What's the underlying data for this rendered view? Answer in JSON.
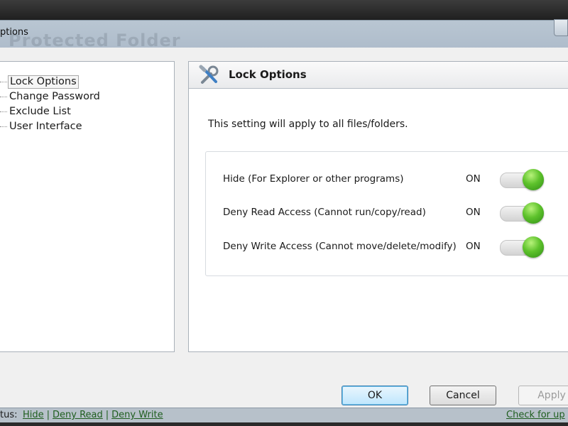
{
  "window": {
    "title": "ptions",
    "ghost_title": "Protected Folder"
  },
  "tree": {
    "items": [
      {
        "label": "Lock Options",
        "selected": true
      },
      {
        "label": "Change Password",
        "selected": false
      },
      {
        "label": "Exclude List",
        "selected": false
      },
      {
        "label": "User Interface",
        "selected": false
      }
    ]
  },
  "panel": {
    "icon": "tools-icon",
    "title": "Lock Options",
    "description": "This setting will apply to all files/folders.",
    "options": [
      {
        "label": "Hide (For Explorer or other programs)",
        "state": "ON",
        "on": true
      },
      {
        "label": "Deny Read Access (Cannot run/copy/read)",
        "state": "ON",
        "on": true
      },
      {
        "label": "Deny Write Access (Cannot move/delete/modify)",
        "state": "ON",
        "on": true
      }
    ],
    "toggle_color": "#5ec22c"
  },
  "buttons": {
    "ok": "OK",
    "cancel": "Cancel",
    "apply": "Apply"
  },
  "statusbar": {
    "label": "tus:",
    "links": [
      "Hide",
      "Deny Read",
      "Deny Write"
    ],
    "update_link": "Check for up"
  }
}
